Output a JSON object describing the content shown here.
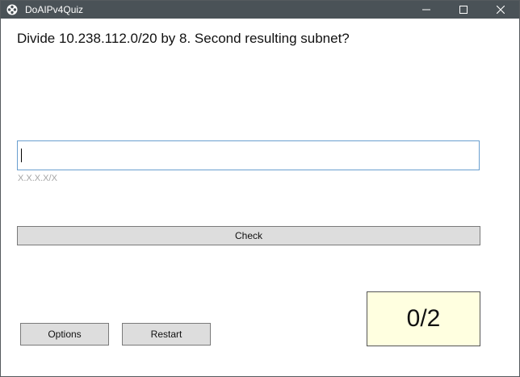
{
  "window": {
    "title": "DoAIPv4Quiz",
    "icons": [
      "app-icon",
      "minimize-icon",
      "maximize-icon",
      "close-icon"
    ]
  },
  "quiz": {
    "question": "Divide 10.238.112.0/20 by 8. Second resulting subnet?",
    "answer_value": "",
    "answer_hint": "X.X.X.X/X",
    "check_label": "Check",
    "score": "0/2"
  },
  "buttons": {
    "options_label": "Options",
    "restart_label": "Restart"
  },
  "colors": {
    "titlebar": "#4a5257",
    "input_border": "#6a9fcf",
    "button_bg": "#dddddd",
    "score_bg": "#ffffe0"
  }
}
